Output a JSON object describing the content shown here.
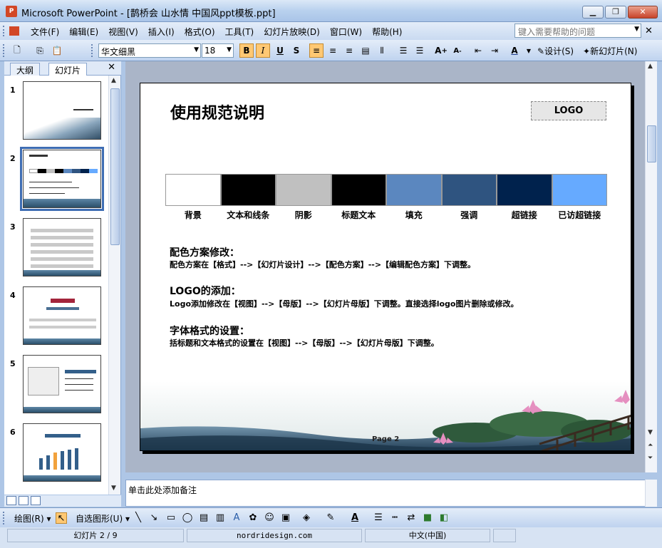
{
  "window": {
    "title": "Microsoft PowerPoint - [鹊桥会 山水情 中国风ppt模板.ppt]",
    "app_icon": "powerpoint-icon"
  },
  "menu": {
    "items": [
      "文件(F)",
      "编辑(E)",
      "视图(V)",
      "插入(I)",
      "格式(O)",
      "工具(T)",
      "幻灯片放映(D)",
      "窗口(W)",
      "帮助(H)"
    ],
    "help_placeholder": "键入需要帮助的问题"
  },
  "toolbar": {
    "font_name": "华文细黑",
    "font_size": "18",
    "design_label": "设计(S)",
    "new_slide_label": "新幻灯片(N)"
  },
  "panel": {
    "tab_outline": "大纲",
    "tab_slides": "幻灯片",
    "thumb_numbers": [
      "1",
      "2",
      "3",
      "4",
      "5",
      "6"
    ]
  },
  "slide": {
    "title": "使用规范说明",
    "logo": "LOGO",
    "swatches": [
      {
        "label": "背景",
        "color": "#ffffff"
      },
      {
        "label": "文本和线条",
        "color": "#000000"
      },
      {
        "label": "阴影",
        "color": "#c0c0c0"
      },
      {
        "label": "标题文本",
        "color": "#000000"
      },
      {
        "label": "填充",
        "color": "#5b87bf"
      },
      {
        "label": "强调",
        "color": "#2f5480"
      },
      {
        "label": "超链接",
        "color": "#00224d"
      },
      {
        "label": "已访超链接",
        "color": "#66aaff"
      }
    ],
    "sections": [
      {
        "heading": "配色方案修改：",
        "body": "配色方案在【格式】-->【幻灯片设计】-->【配色方案】-->【编辑配色方案】下调整。"
      },
      {
        "heading": "LOGO的添加：",
        "body": "Logo添加修改在【视图】-->【母版】-->【幻灯片母版】下调整。直接选择logo图片删除或修改。"
      },
      {
        "heading": "字体格式的设置：",
        "body": "括标题和文本格式的设置在【视图】-->【母版】-->【幻灯片母版】下调整。"
      }
    ],
    "page_label": "Page  2"
  },
  "notes": {
    "placeholder": "单击此处添加备注"
  },
  "drawbar": {
    "draw_label": "绘图(R)",
    "autoshape_label": "自选图形(U)"
  },
  "status": {
    "slide_pos": "幻灯片 2 / 9",
    "template": "nordridesign.com",
    "language": "中文(中国)"
  }
}
